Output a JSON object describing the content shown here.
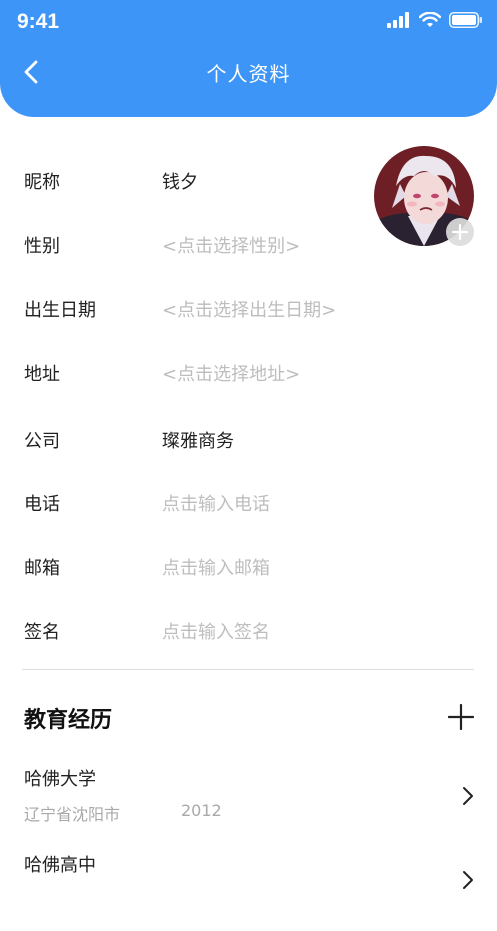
{
  "status_bar": {
    "time": "9:41"
  },
  "header": {
    "title": "个人资料"
  },
  "profile": {
    "rows": [
      {
        "label": "昵称",
        "value": "钱夕",
        "placeholder": false
      },
      {
        "label": "性别",
        "value": "<点击选择性别>",
        "placeholder": true
      },
      {
        "label": "出生日期",
        "value": "<点击选择出生日期>",
        "placeholder": true
      },
      {
        "label": "地址",
        "value": "<点击选择地址>",
        "placeholder": true
      },
      {
        "label": "公司",
        "value": "璨雅商务",
        "placeholder": false
      },
      {
        "label": "电话",
        "value": "点击输入电话",
        "placeholder": true
      },
      {
        "label": "邮箱",
        "value": "点击输入邮箱",
        "placeholder": true
      },
      {
        "label": "签名",
        "value": "点击输入签名",
        "placeholder": true
      }
    ]
  },
  "education": {
    "title": "教育经历",
    "items": [
      {
        "school": "哈佛大学",
        "location": "辽宁省沈阳市",
        "year": "2012"
      },
      {
        "school": "哈佛高中"
      }
    ]
  },
  "colors": {
    "accent": "#3d96f7",
    "placeholder": "#bdbdbd",
    "secondary_text": "#a9a9a9"
  }
}
